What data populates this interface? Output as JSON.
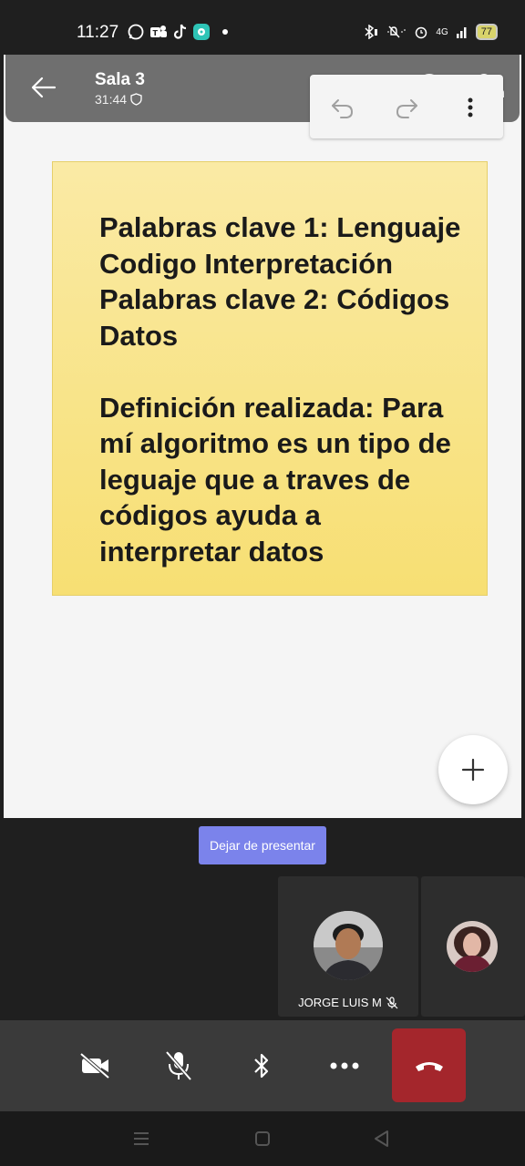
{
  "status_bar": {
    "time": "11:27",
    "battery": "77",
    "network": "4G",
    "icons": [
      "whatsapp-icon",
      "teams-icon",
      "tiktok-icon",
      "chat-app-icon",
      "bluetooth-icon",
      "mute-icon",
      "alarm-icon",
      "signal-icon",
      "battery-icon"
    ]
  },
  "header": {
    "title": "Sala 3",
    "duration": "31:44",
    "icons": [
      "back-arrow-icon",
      "shield-icon",
      "chat-icon",
      "people-icon"
    ]
  },
  "whiteboard_toolbar": {
    "icons": [
      "undo-icon",
      "redo-icon",
      "more-vertical-icon"
    ]
  },
  "sticky_note": {
    "paragraph1": "Palabras clave 1: Lenguaje Codigo Interpretación Palabras clave 2: Códigos Datos",
    "paragraph2": "Definición realizada: Para mí algoritmo es un tipo de leguaje que a traves de códigos ayuda a interpretar datos",
    "color": "#f8e38a"
  },
  "stop_presenting": {
    "label": "Dejar de presentar",
    "color": "#7b83eb"
  },
  "participants": [
    {
      "name": "JORGE LUIS M",
      "muted": true
    },
    {
      "name": "",
      "muted": false
    }
  ],
  "controls": {
    "icons": [
      "camera-off-icon",
      "mic-off-icon",
      "bluetooth-audio-icon",
      "more-horizontal-icon",
      "hang-up-icon"
    ],
    "hangup_color": "#a4262c"
  }
}
